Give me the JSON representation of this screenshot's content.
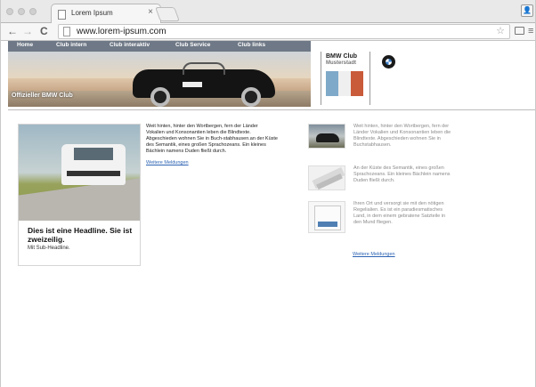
{
  "browser": {
    "tab_title": "Lorem Ipsum",
    "tab_close": "×",
    "url": "www.lorem-ipsum.com",
    "profile_glyph": "👤",
    "menu_glyph": "≡"
  },
  "site": {
    "nav": [
      "Home",
      "Club intern",
      "Club interaktiv",
      "Club Service",
      "Club links"
    ],
    "hero_caption": "Offizieller BMW Club",
    "club_name": "BMW Club",
    "club_city": "Musterstadt",
    "flag_colors": [
      "#7fa9c9",
      "#efefef",
      "#c95a3a"
    ]
  },
  "feature": {
    "headline": "Dies ist eine Headline. Sie ist zweizeilig.",
    "subheadline": "Mit Sub-Headline."
  },
  "article": {
    "text": "Weit hinten, hinter den Wortbergen, fern der Länder Vokalien und Konsonantien leben die Blindtexte. Abgeschieden wohnen Sie in Buch-stabhausen.an der Küste des Semantik, eines großen Sprachozeans. Ein kleines Bächlein namens Duden fließt durch.",
    "link": "Weitere Meldungen"
  },
  "news": {
    "items": [
      {
        "text": "Weit hinten, hinter den Wortbergen, fern der Länder Vokalien und Konsonantien leben die Blindtexte. Abgeschieden wohnen Sie in Buchstabhausen.",
        "thumb_icon": "car-thumbnail-icon"
      },
      {
        "text": "An der Küste des Semantik, eines großen Sprachozeans. Ein kleines Bächlein namens Duden fließt durch.",
        "thumb_icon": "paper-thumbnail-icon"
      },
      {
        "text": "Ihren Ort und versorgt sie mit den nötigen Regelialien. Es ist ein paradiesmatisches Land, in dem einem gebratene Satzteile in den Mund fliegen.",
        "thumb_icon": "book-thumbnail-icon"
      }
    ],
    "link": "Weitere Meldungen"
  }
}
